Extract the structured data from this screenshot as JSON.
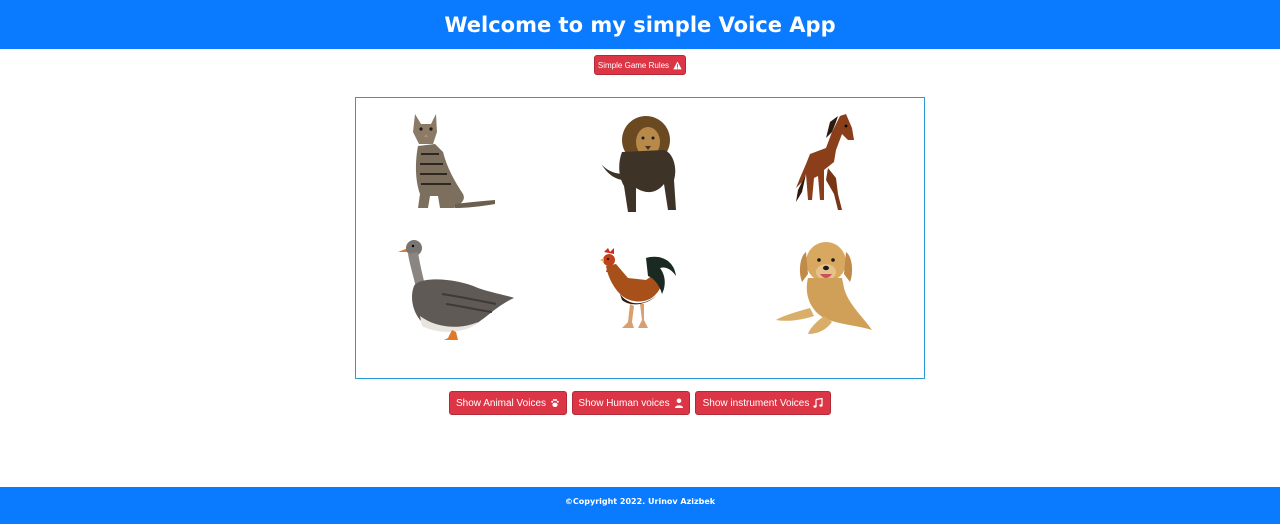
{
  "header": {
    "title": "Welcome to my simple Voice App"
  },
  "rules_button": {
    "label": "Simple Game Rules",
    "icon": "warning-triangle-icon"
  },
  "animals": [
    {
      "name": "cat"
    },
    {
      "name": "lion"
    },
    {
      "name": "horse"
    },
    {
      "name": "goose"
    },
    {
      "name": "rooster"
    },
    {
      "name": "dog"
    }
  ],
  "buttons": {
    "animal": {
      "label": "Show Animal Voices",
      "icon": "paw-icon"
    },
    "human": {
      "label": "Show Human voices",
      "icon": "user-icon"
    },
    "instrument": {
      "label": "Show instrument Voices",
      "icon": "music-note-icon"
    }
  },
  "footer": {
    "text": "©Copyright 2022. Urinov Azizbek"
  },
  "colors": {
    "primary": "#0a7bff",
    "danger": "#dc3545",
    "border": "#2a9ad6"
  }
}
